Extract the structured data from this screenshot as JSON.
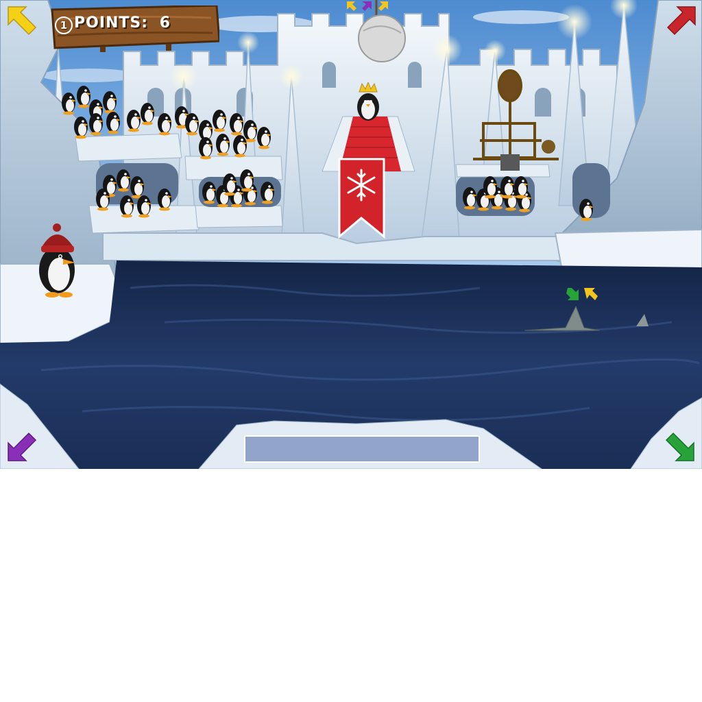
{
  "hud": {
    "player_number": "1",
    "points_label": "POINTS:",
    "points_value": "6"
  },
  "input_bar": {
    "value": ""
  },
  "corners": {
    "top_left": {
      "icon": "arrow-up-left-icon",
      "color": "#f5d116"
    },
    "top_right": {
      "icon": "arrow-up-right-icon",
      "color": "#c8262a"
    },
    "bottom_left": {
      "icon": "arrow-down-left-icon",
      "color": "#8a2fb8"
    },
    "bottom_right": {
      "icon": "arrow-down-right-icon",
      "color": "#27a33a"
    }
  },
  "colors": {
    "water": "#1f3560",
    "ice": "#dbe7f1",
    "sky": "#6fa8de",
    "banner": "#d2232a",
    "wood": "#7a4a1c"
  }
}
